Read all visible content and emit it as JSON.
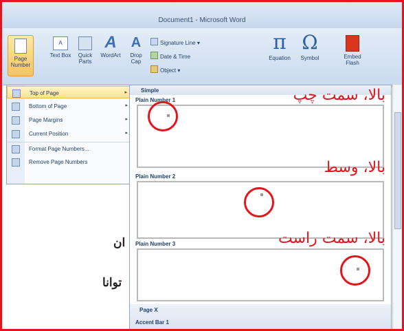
{
  "window": {
    "title": "Document1 - Microsoft Word"
  },
  "ribbon": {
    "page_number": "Page Number",
    "text_box": "Text Box",
    "quick_parts": "Quick Parts",
    "wordart": "WordArt",
    "drop_cap": "Drop Cap",
    "signature_line": "Signature Line",
    "date_time": "Date & Time",
    "object": "Object",
    "equation": "Equation",
    "symbol": "Symbol",
    "embed_flash": "Embed Flash",
    "pi_glyph": "π",
    "omega_glyph": "Ω"
  },
  "menu": {
    "items": [
      {
        "label": "Top of Page",
        "arrow": "▸"
      },
      {
        "label": "Bottom of Page",
        "arrow": "▸"
      },
      {
        "label": "Page Margins",
        "arrow": "▸"
      },
      {
        "label": "Current Position",
        "arrow": "▸"
      },
      {
        "label": "Format Page Numbers..."
      },
      {
        "label": "Remove Page Numbers"
      }
    ]
  },
  "gallery": {
    "section_simple": "Simple",
    "items": [
      "Plain Number 1",
      "Plain Number 2",
      "Plain Number 3"
    ],
    "section_page_x": "Page X",
    "accent_bar": "Accent Bar 1"
  },
  "document": {
    "word1": "ان",
    "word2": "توانا"
  },
  "annotations": {
    "top_left": "بالا، سمت چپ",
    "top_center": "بالا، وسط",
    "top_right": "بالا، سمت راست"
  }
}
